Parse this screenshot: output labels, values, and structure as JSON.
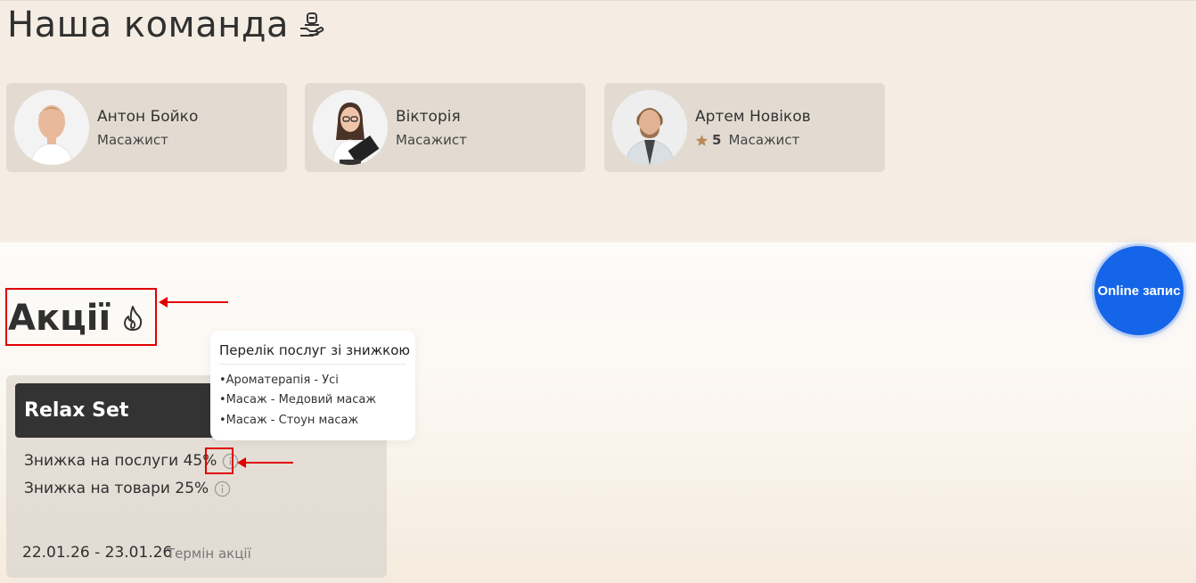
{
  "team": {
    "title": "Наша команда",
    "members": [
      {
        "name": "Антон Бойко",
        "role": "Масажист"
      },
      {
        "name": "Вікторія",
        "role": "Масажист"
      },
      {
        "name": "Артем Новіков",
        "role": "Масажист",
        "rating": "5"
      }
    ]
  },
  "promotions": {
    "title": "Акції",
    "card": {
      "name": "Relax Set",
      "services_discount": "Знижка на послуги 45%",
      "goods_discount": "Знижка на товари 25%",
      "dates": "22.01.26 - 23.01.26",
      "term_label": "Термін акції"
    },
    "tooltip": {
      "title": "Перелік послуг зі знижкою",
      "items": [
        "•Ароматерапія - Усі",
        "•Масаж - Медовий масаж",
        "•Масаж - Стоун масаж"
      ]
    }
  },
  "online_booking": {
    "label": "Online запис"
  },
  "colors": {
    "accent_blue": "#1565e8",
    "annotation_red": "#e00000",
    "card_dark": "#333333",
    "star": "#b8895a"
  }
}
